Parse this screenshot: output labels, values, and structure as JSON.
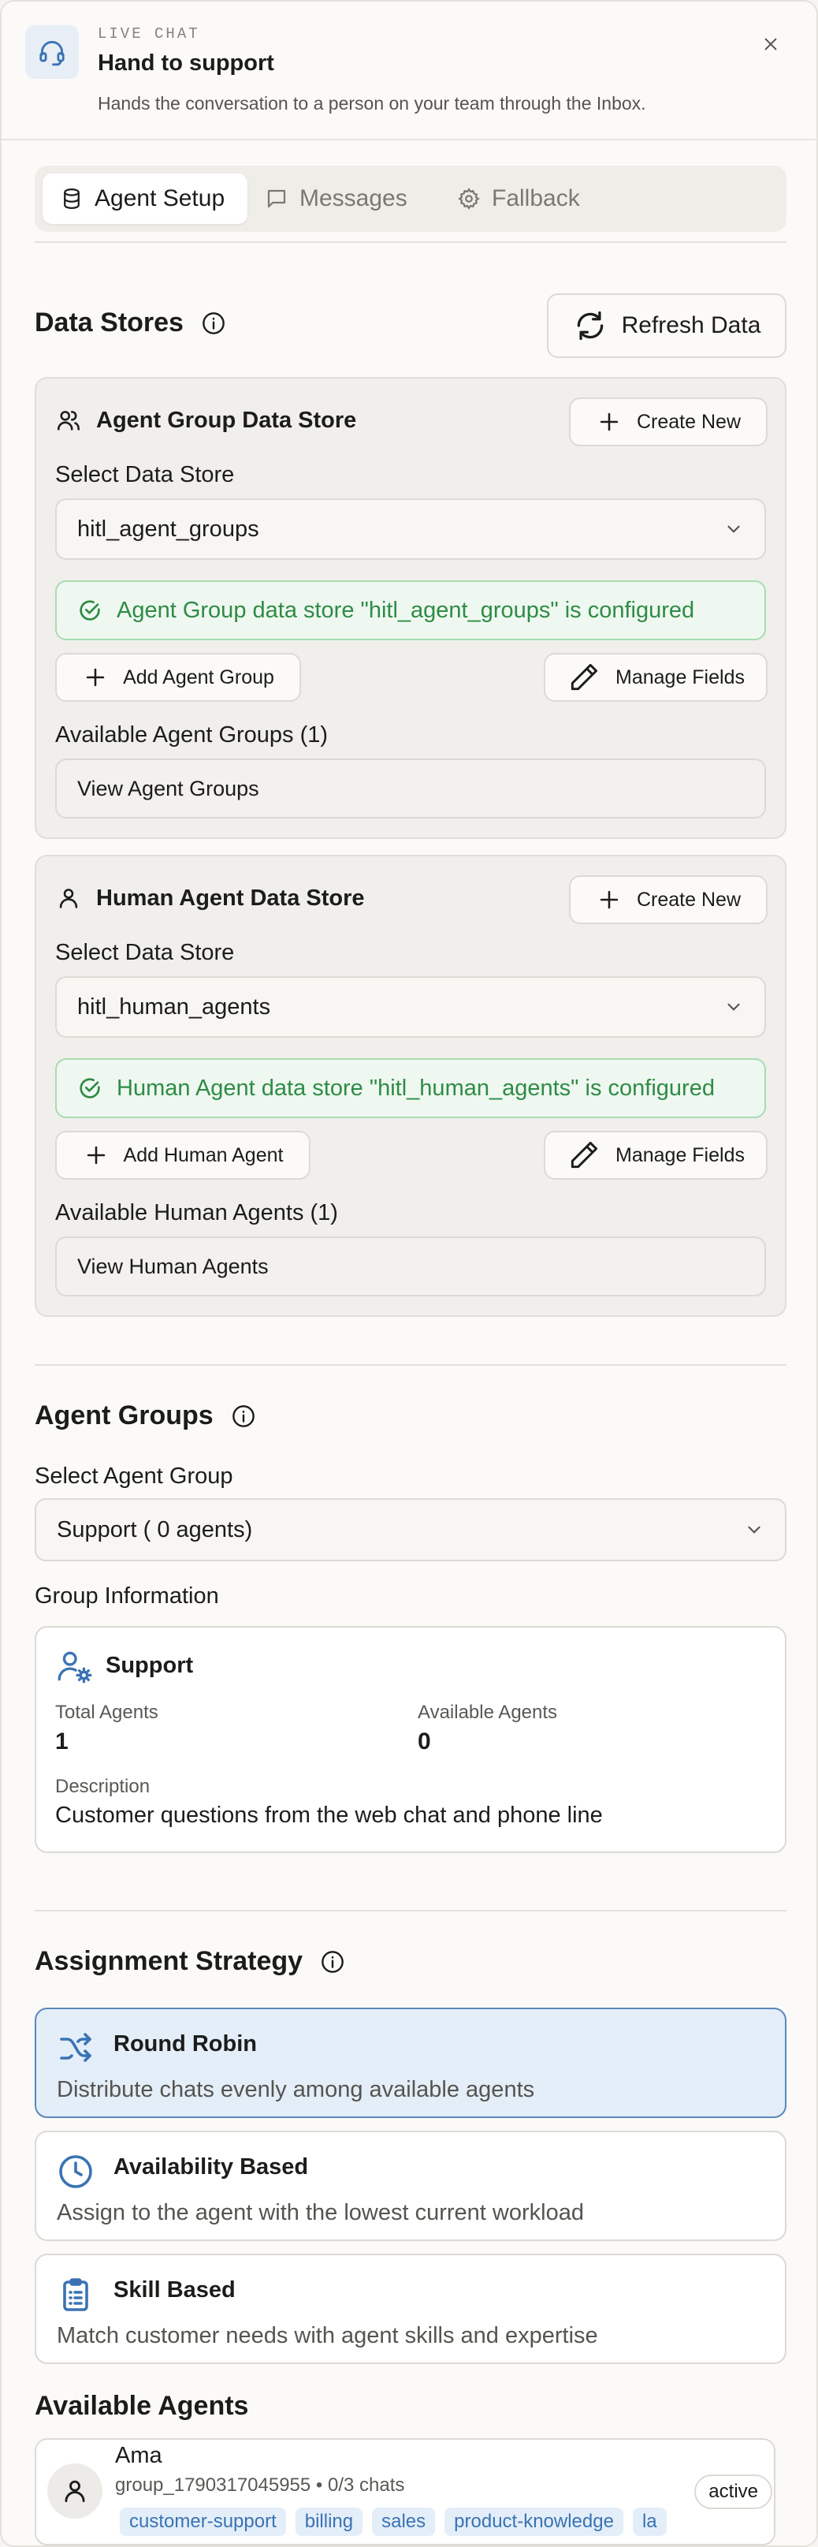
{
  "header": {
    "eyebrow": "LIVE CHAT",
    "title": "Hand to support",
    "subtitle": "Hands the conversation to a person on your team through the Inbox.",
    "icon": "headset-icon",
    "close_icon": "close-icon"
  },
  "tabs": [
    {
      "label": "Agent Setup",
      "icon": "database-icon",
      "active": true
    },
    {
      "label": "Messages",
      "icon": "message-icon",
      "active": false
    },
    {
      "label": "Fallback",
      "icon": "gear-icon",
      "active": false
    }
  ],
  "data_stores": {
    "title": "Data Stores",
    "refresh_label": "Refresh Data",
    "agent_group_store": {
      "title": "Agent Group Data Store",
      "create_label": "Create New",
      "select_label": "Select Data Store",
      "selected": "hitl_agent_groups",
      "status": "Agent Group data store \"hitl_agent_groups\" is configured",
      "add_label": "Add Agent Group",
      "manage_label": "Manage Fields",
      "available_label": "Available Agent Groups (1)",
      "view_label": "View Agent Groups"
    },
    "human_agent_store": {
      "title": "Human Agent Data Store",
      "create_label": "Create New",
      "select_label": "Select Data Store",
      "selected": "hitl_human_agents",
      "status": "Human Agent data store \"hitl_human_agents\" is configured",
      "add_label": "Add Human Agent",
      "manage_label": "Manage Fields",
      "available_label": "Available Human Agents (1)",
      "view_label": "View Human Agents"
    }
  },
  "agent_groups": {
    "title": "Agent Groups",
    "select_label": "Select Agent Group",
    "selected": "Support ( 0 agents)",
    "info_heading": "Group Information",
    "group_name": "Support",
    "total_label": "Total Agents",
    "total_value": "1",
    "available_label": "Available Agents",
    "available_value": "0",
    "description_label": "Description",
    "description": "Customer questions from the web chat and phone line"
  },
  "assignment": {
    "title": "Assignment Strategy",
    "options": [
      {
        "title": "Round Robin",
        "desc": "Distribute chats evenly among available agents",
        "icon": "shuffle-icon",
        "selected": true
      },
      {
        "title": "Availability Based",
        "desc": "Assign to the agent with the lowest current workload",
        "icon": "clock-icon",
        "selected": false
      },
      {
        "title": "Skill Based",
        "desc": "Match customer needs with agent skills and expertise",
        "icon": "clipboard-icon",
        "selected": false
      }
    ]
  },
  "available_agents": {
    "title": "Available Agents",
    "agents": [
      {
        "name": "Ama",
        "meta": "group_1790317045955 • 0/3 chats",
        "status": "active",
        "tags": [
          "customer-support",
          "billing",
          "sales",
          "product-knowledge",
          "la"
        ]
      }
    ]
  },
  "colors": {
    "accent": "#3a73b3",
    "success": "#2f8b46",
    "selected_bg": "#e3eef9"
  }
}
